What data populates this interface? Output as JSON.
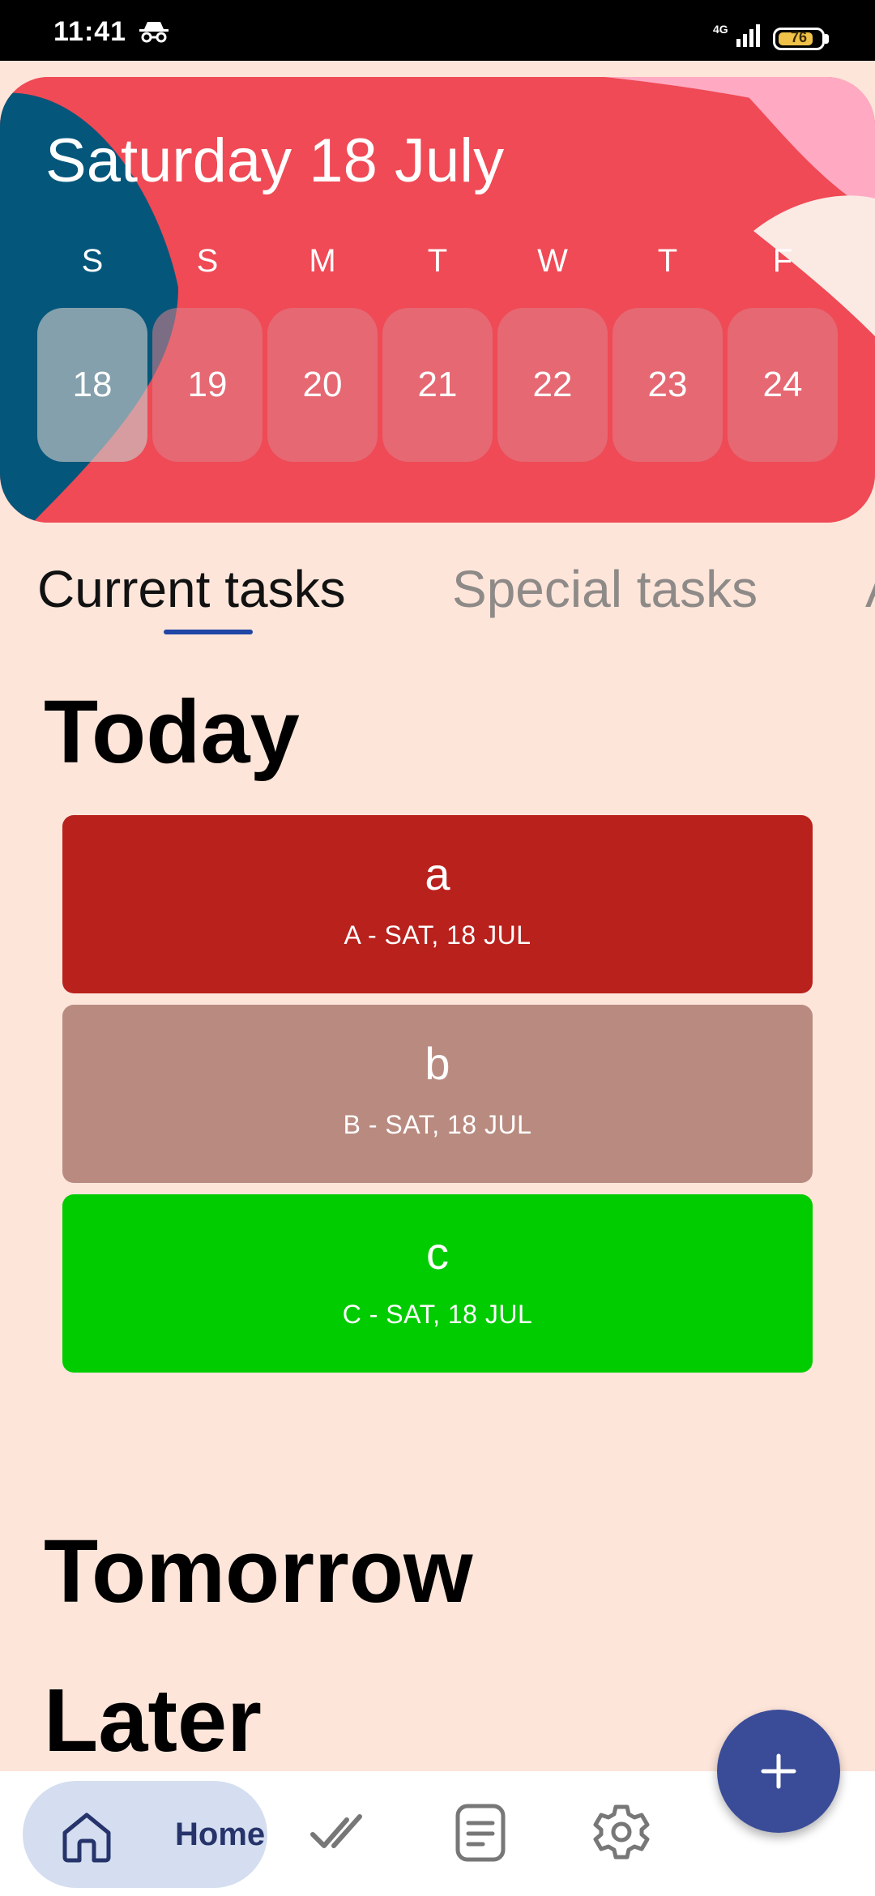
{
  "status_bar": {
    "time": "11:41",
    "network": "4G",
    "battery": "76"
  },
  "header": {
    "title": "Saturday 18 July",
    "weekdays": [
      "S",
      "S",
      "M",
      "T",
      "W",
      "T",
      "F"
    ],
    "days": [
      "18",
      "19",
      "20",
      "21",
      "22",
      "23",
      "24"
    ],
    "selected_day": "18"
  },
  "tabs": [
    "Current tasks",
    "Special tasks",
    "A"
  ],
  "sections": {
    "today": "Today",
    "tomorrow": "Tomorrow",
    "later": "Later"
  },
  "tasks": [
    {
      "title": "a",
      "subtitle": "A - SAT, 18 JUL",
      "color": "#b9211d"
    },
    {
      "title": "b",
      "subtitle": "B - SAT, 18 JUL",
      "color": "#b98b80"
    },
    {
      "title": "c",
      "subtitle": "C - SAT, 18 JUL",
      "color": "#00cc00"
    }
  ],
  "bottom_nav": {
    "home_label": "Home"
  },
  "colors": {
    "background": "#fde5da",
    "accent": "#3a4c98",
    "header_red": "#ef4a55",
    "header_navy": "#04567a",
    "header_pink": "#ffaac2"
  }
}
